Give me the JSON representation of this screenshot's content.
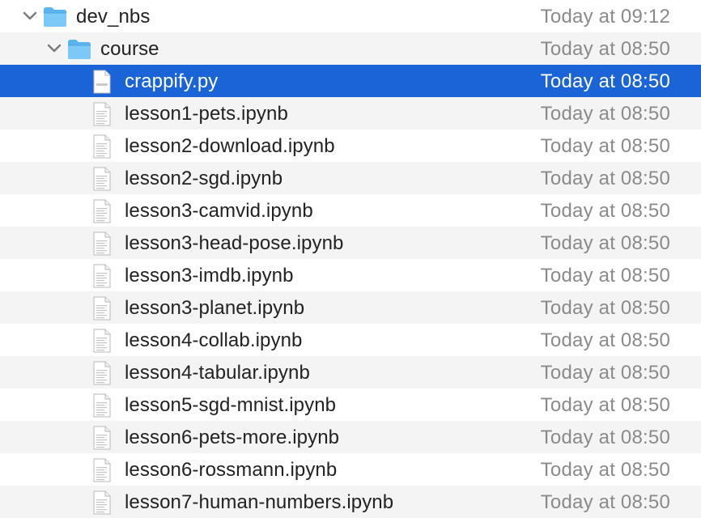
{
  "colors": {
    "selection": "#1a64d8",
    "folder": "#5ab4ee",
    "date_text": "#8a8a8a",
    "alternate_row": "#f4f4f4"
  },
  "rows": [
    {
      "name": "dev_nbs",
      "date": "Today at 09:12",
      "kind": "folder",
      "depth": 0,
      "expanded": true,
      "selected": false
    },
    {
      "name": "course",
      "date": "Today at 08:50",
      "kind": "folder",
      "depth": 1,
      "expanded": true,
      "selected": false
    },
    {
      "name": "crappify.py",
      "date": "Today at 08:50",
      "kind": "python",
      "depth": 2,
      "selected": true
    },
    {
      "name": "lesson1-pets.ipynb",
      "date": "Today at 08:50",
      "kind": "document",
      "depth": 2,
      "selected": false
    },
    {
      "name": "lesson2-download.ipynb",
      "date": "Today at 08:50",
      "kind": "document",
      "depth": 2,
      "selected": false
    },
    {
      "name": "lesson2-sgd.ipynb",
      "date": "Today at 08:50",
      "kind": "document",
      "depth": 2,
      "selected": false
    },
    {
      "name": "lesson3-camvid.ipynb",
      "date": "Today at 08:50",
      "kind": "document",
      "depth": 2,
      "selected": false
    },
    {
      "name": "lesson3-head-pose.ipynb",
      "date": "Today at 08:50",
      "kind": "document",
      "depth": 2,
      "selected": false
    },
    {
      "name": "lesson3-imdb.ipynb",
      "date": "Today at 08:50",
      "kind": "document",
      "depth": 2,
      "selected": false
    },
    {
      "name": "lesson3-planet.ipynb",
      "date": "Today at 08:50",
      "kind": "document",
      "depth": 2,
      "selected": false
    },
    {
      "name": "lesson4-collab.ipynb",
      "date": "Today at 08:50",
      "kind": "document",
      "depth": 2,
      "selected": false
    },
    {
      "name": "lesson4-tabular.ipynb",
      "date": "Today at 08:50",
      "kind": "document",
      "depth": 2,
      "selected": false
    },
    {
      "name": "lesson5-sgd-mnist.ipynb",
      "date": "Today at 08:50",
      "kind": "document",
      "depth": 2,
      "selected": false
    },
    {
      "name": "lesson6-pets-more.ipynb",
      "date": "Today at 08:50",
      "kind": "document",
      "depth": 2,
      "selected": false
    },
    {
      "name": "lesson6-rossmann.ipynb",
      "date": "Today at 08:50",
      "kind": "document",
      "depth": 2,
      "selected": false
    },
    {
      "name": "lesson7-human-numbers.ipynb",
      "date": "Today at 08:50",
      "kind": "document",
      "depth": 2,
      "selected": false
    }
  ]
}
